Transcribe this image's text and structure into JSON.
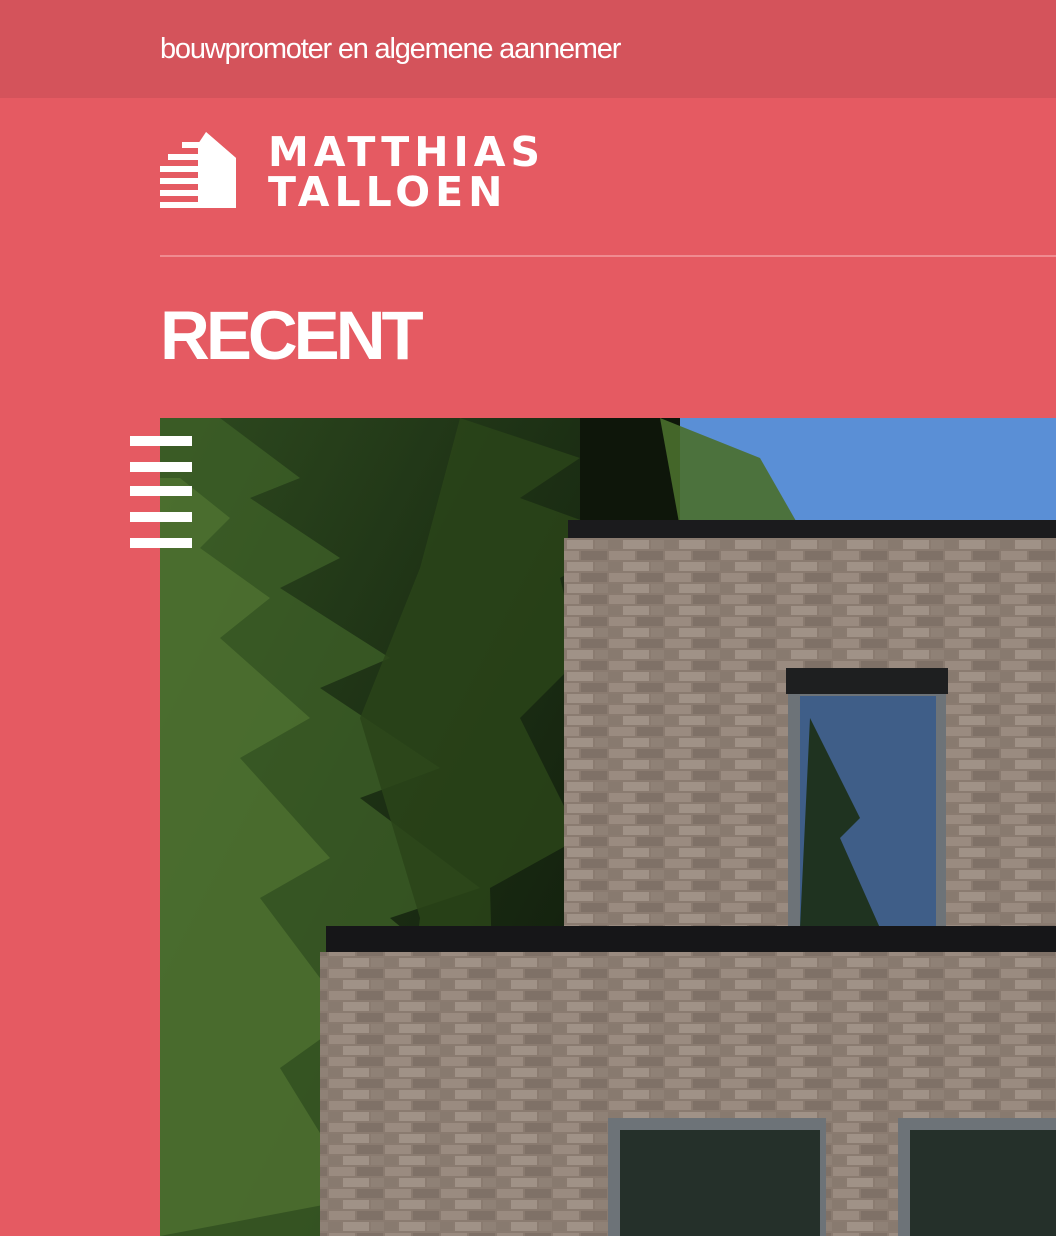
{
  "topbar": {
    "tagline": "bouwpromoter en algemene aannemer"
  },
  "brand": {
    "name_line1": "MATTHIAS",
    "name_line2": "TALLOEN",
    "logo_icon": "house-stripes-icon"
  },
  "section": {
    "title": "RECENT"
  },
  "hero": {
    "image_subject": "brick house between trees"
  },
  "menu": {
    "icon": "hamburger-menu-icon"
  },
  "colors": {
    "brand_red": "#e55a62",
    "topbar_red": "#d4535b",
    "divider": "#f08b90",
    "text": "#ffffff"
  }
}
